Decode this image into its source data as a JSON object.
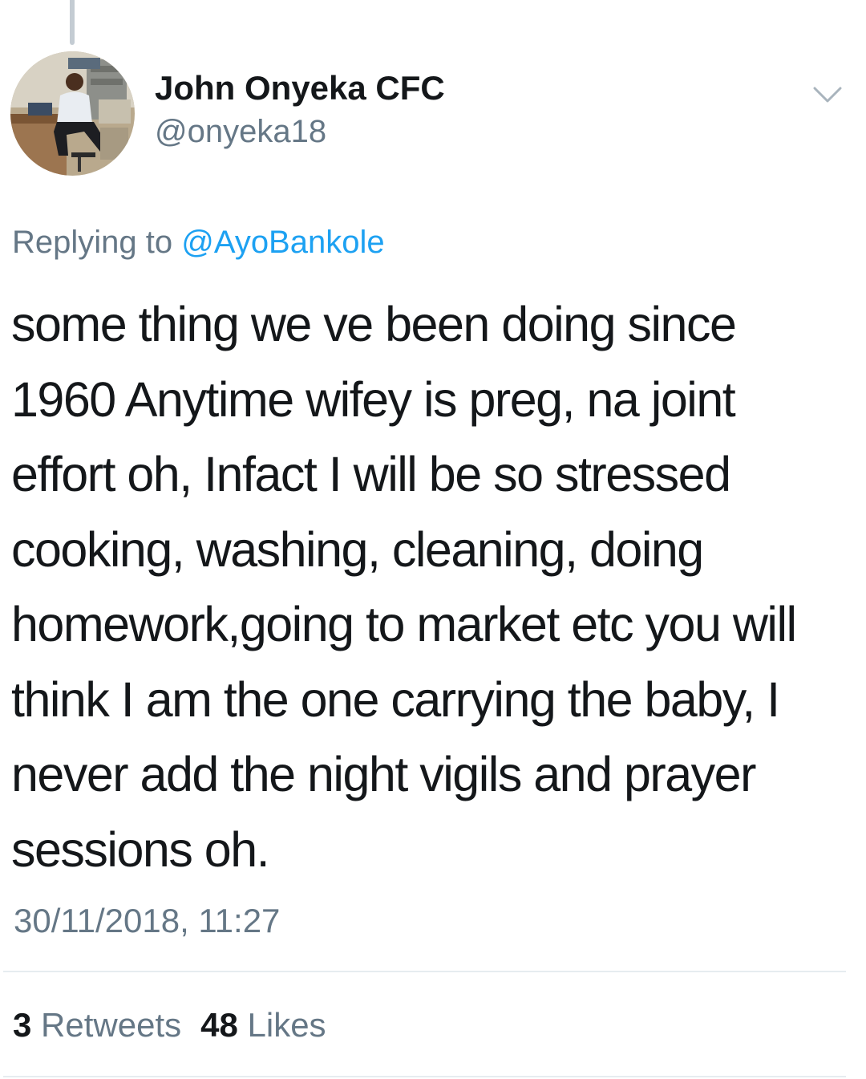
{
  "tweet": {
    "author": {
      "name": "John Onyeka CFC",
      "handle": "@onyeka18",
      "avatar_icon": "profile-photo"
    },
    "reply_context": {
      "prefix": "Replying to",
      "mention": "@AyoBankole"
    },
    "text": "some thing we ve been doing since\n1960 Anytime wifey is preg, na joint\neffort oh, Infact I will be so stressed\ncooking, washing, cleaning, doing\nhomework,going to market etc you will\nthink I am the one carrying the baby, I\nnever add the night vigils and prayer\nsessions oh.",
    "timestamp": "30/11/2018, 11:27",
    "stats": {
      "retweets_count": "3",
      "retweets_label": "Retweets",
      "likes_count": "48",
      "likes_label": "Likes"
    }
  },
  "icons": {
    "menu": "chevron-down-icon"
  },
  "colors": {
    "text_primary": "#14171a",
    "text_secondary": "#657786",
    "link": "#1da1f2",
    "divider": "#e6ecf0"
  }
}
